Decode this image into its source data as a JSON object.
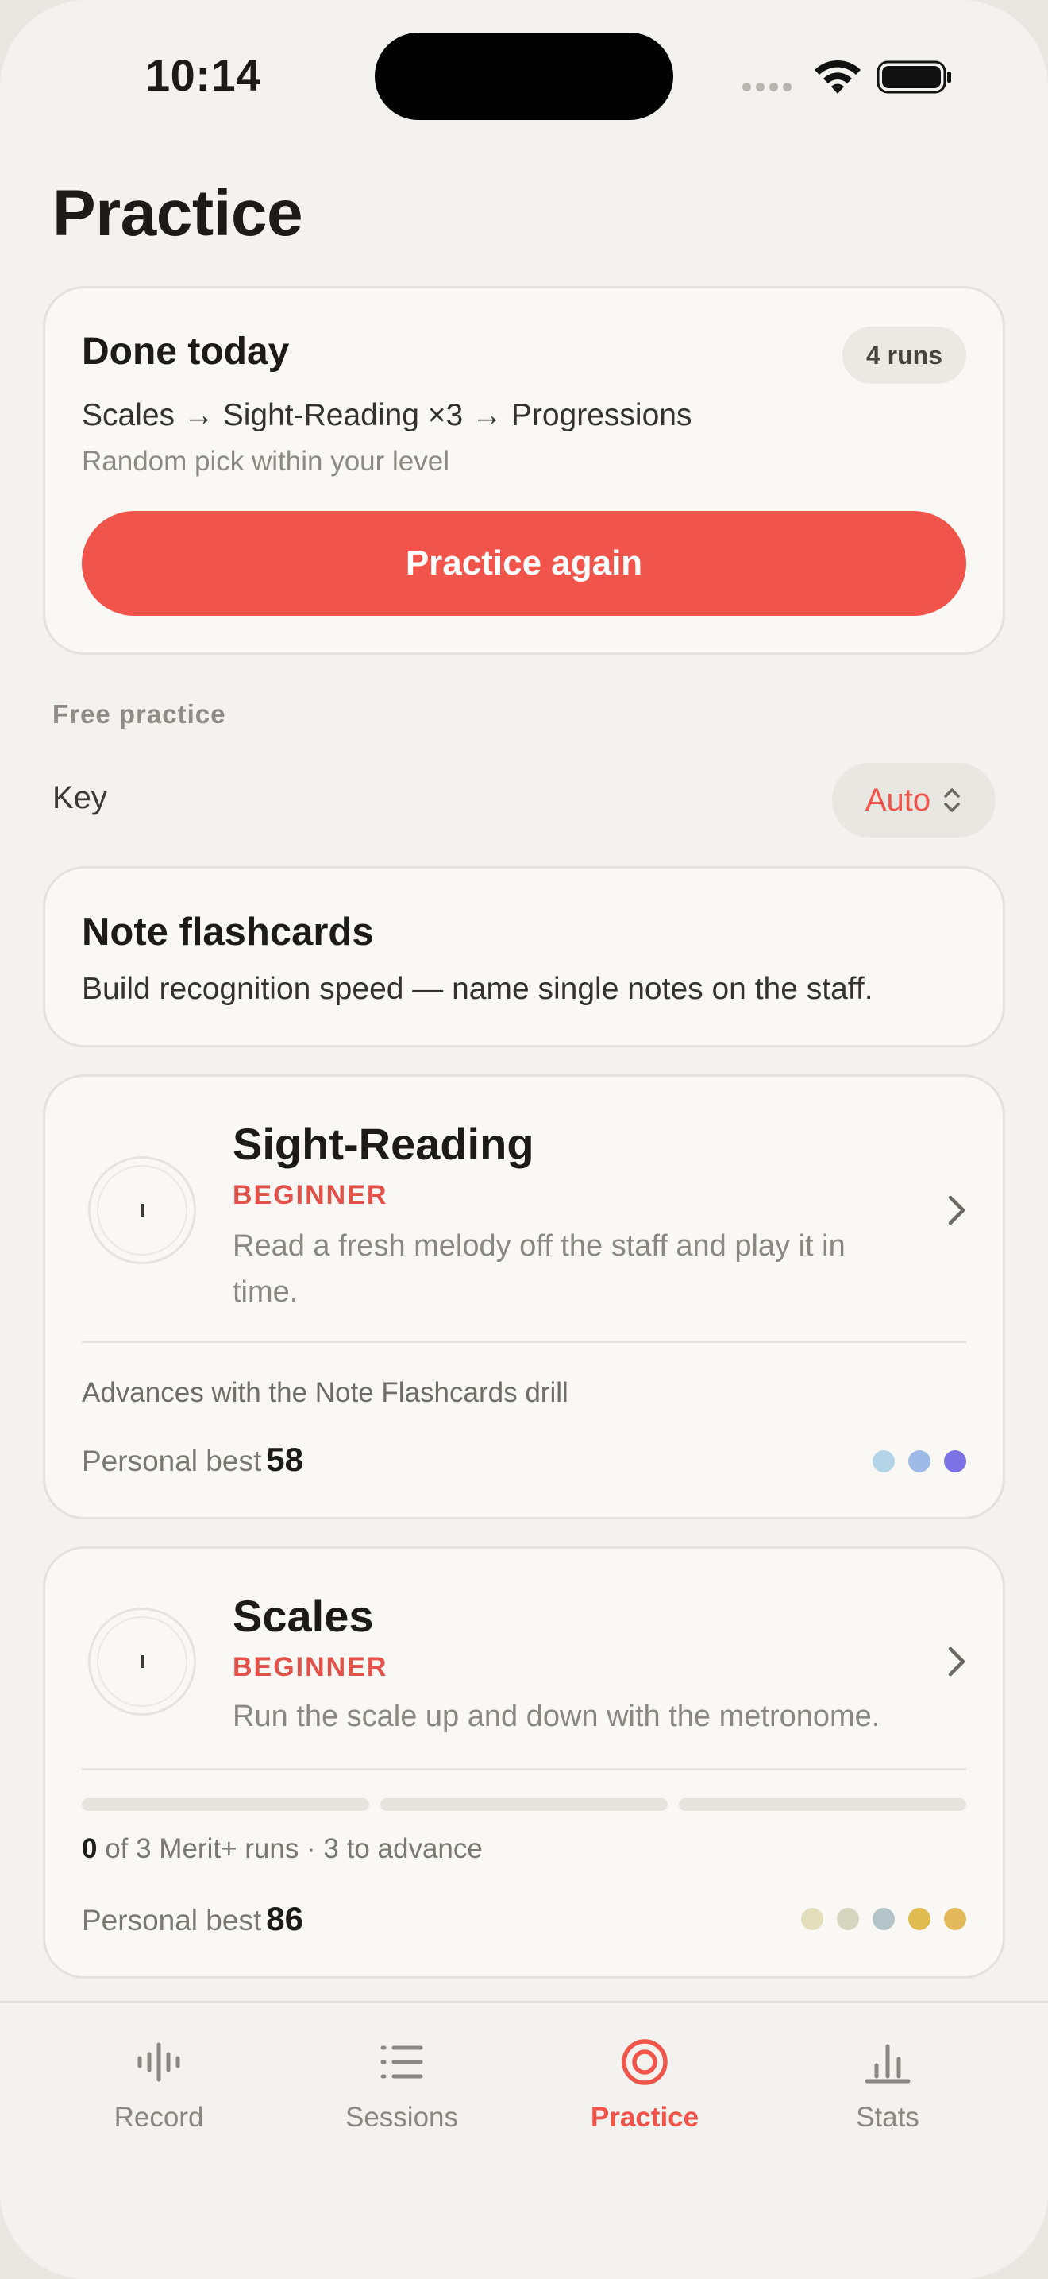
{
  "status_bar": {
    "time": "10:14"
  },
  "page": {
    "title": "Practice"
  },
  "done_today": {
    "title": "Done today",
    "badge": "4 runs",
    "sequence": "Scales → Sight-Reading ×3 → Progressions",
    "note": "Random pick within your level",
    "button_label": "Practice again"
  },
  "free_practice": {
    "section_label": "Free practice",
    "key_label": "Key",
    "key_value": "Auto"
  },
  "flashcards": {
    "title": "Note flashcards",
    "description": "Build recognition speed — name single notes on the staff."
  },
  "sight_reading": {
    "title": "Sight-Reading",
    "level": "BEGINNER",
    "description": "Read a fresh melody off the staff and play it in time.",
    "advance_note": "Advances with the Note Flashcards drill",
    "pb_label": "Personal best",
    "pb_value": "58",
    "dot_colors": [
      "#b4d4e8",
      "#9dbbe6",
      "#7d71e6"
    ]
  },
  "scales": {
    "title": "Scales",
    "level": "BEGINNER",
    "description": "Run the scale up and down with the metronome.",
    "progress": [
      0,
      0,
      0
    ],
    "merit_count": "0",
    "merit_text": "of 3 Merit+ runs · 3 to advance",
    "pb_label": "Personal best",
    "pb_value": "86",
    "dot_colors": [
      "#e3dfbd",
      "#d5d6bf",
      "#b4c3c7",
      "#e0bb50",
      "#e3b95b"
    ]
  },
  "tabs": [
    {
      "label": "Record",
      "icon": "waveform-icon",
      "active": false
    },
    {
      "label": "Sessions",
      "icon": "list-icon",
      "active": false
    },
    {
      "label": "Practice",
      "icon": "target-icon",
      "active": true
    },
    {
      "label": "Stats",
      "icon": "bar-chart-icon",
      "active": false
    }
  ],
  "colors": {
    "accent": "#f0544b",
    "background": "#f3f2ee",
    "card": "#f9f8f5"
  }
}
